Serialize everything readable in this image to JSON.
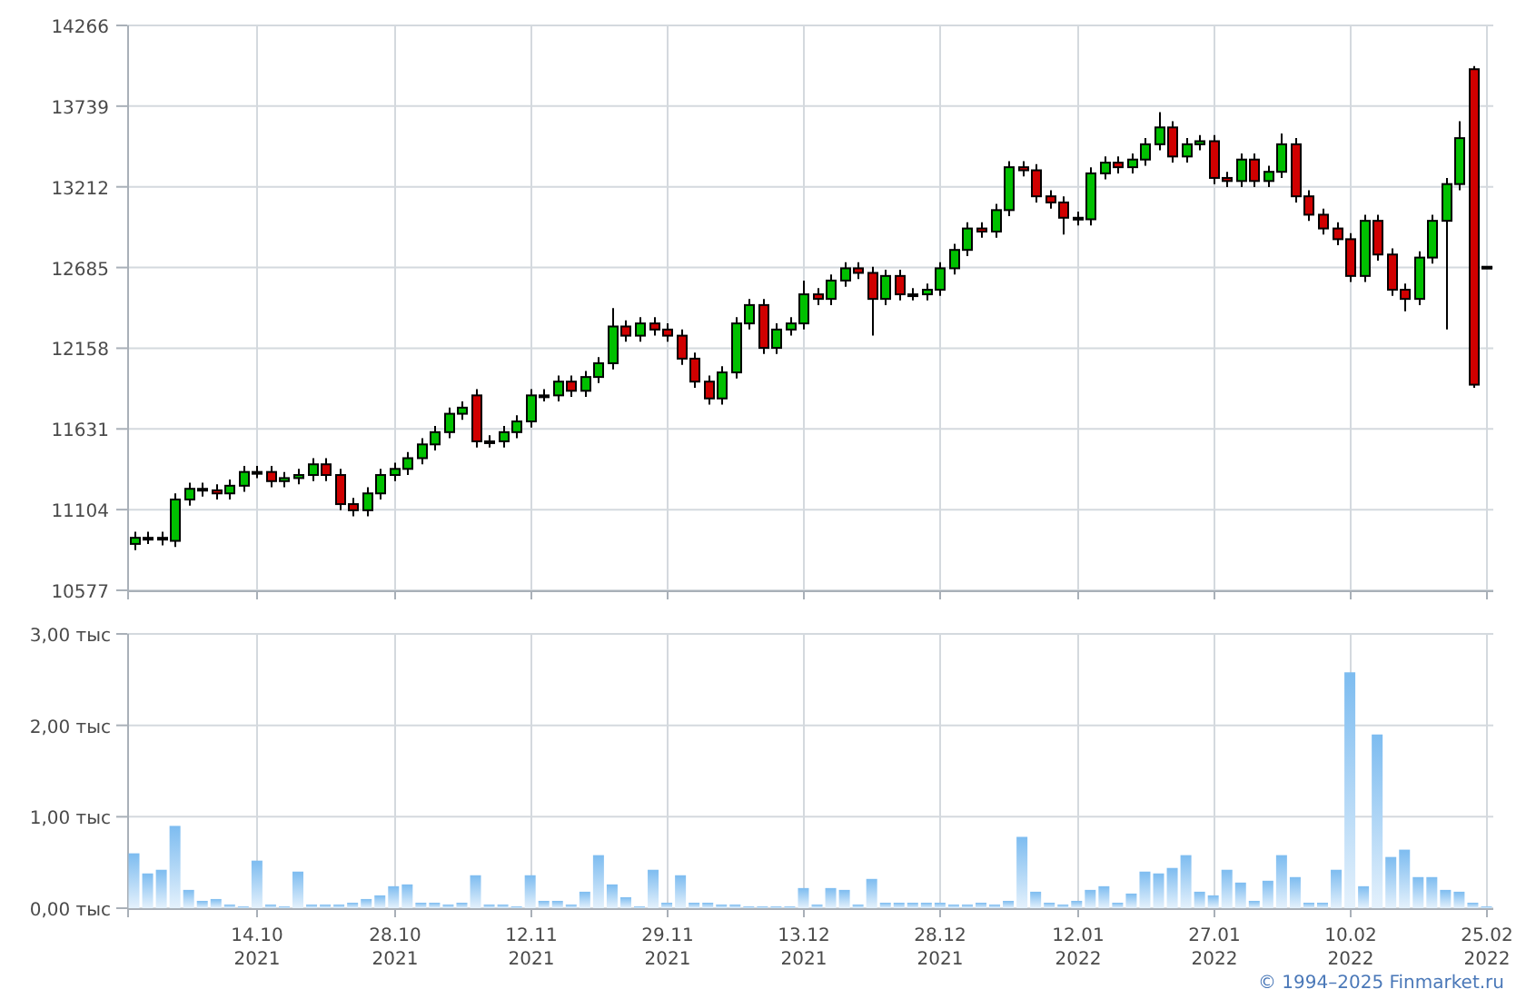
{
  "price_chart": {
    "chart_data": {
      "type": "candlestick",
      "grid": true,
      "ylim": [
        10577,
        14266
      ],
      "yticks": [
        10577,
        11104,
        11631,
        12158,
        12685,
        13212,
        13739,
        14266
      ],
      "categories": [
        null,
        null,
        null,
        null,
        null,
        null,
        null,
        null,
        null,
        null,
        null,
        null,
        null,
        null,
        null,
        null,
        null,
        null,
        null,
        null,
        null,
        null,
        null,
        null,
        null,
        null,
        null,
        null,
        null,
        null,
        null,
        null,
        null,
        null,
        null,
        null,
        null,
        null,
        null,
        null,
        null,
        null,
        null,
        null,
        null,
        null,
        null,
        null,
        null,
        null,
        null,
        null,
        null,
        null,
        null,
        null,
        null,
        null,
        null,
        null,
        null,
        null,
        null,
        null,
        null,
        null,
        null,
        null,
        null,
        null,
        null,
        null,
        null,
        null,
        null,
        null,
        null,
        null,
        null,
        null,
        null,
        null,
        null,
        null,
        null,
        null,
        null,
        null,
        null,
        null,
        null,
        null,
        null,
        null,
        null,
        null,
        null,
        null,
        null,
        null
      ],
      "ohlc": [
        [
          10880,
          10960,
          10840,
          10920
        ],
        [
          10920,
          10960,
          10880,
          10920
        ],
        [
          10920,
          10960,
          10870,
          10910
        ],
        [
          10900,
          11210,
          10860,
          11170
        ],
        [
          11170,
          11280,
          11130,
          11240
        ],
        [
          11240,
          11280,
          11190,
          11230
        ],
        [
          11230,
          11270,
          11170,
          11210
        ],
        [
          11210,
          11300,
          11170,
          11260
        ],
        [
          11260,
          11390,
          11220,
          11350
        ],
        [
          11350,
          11390,
          11310,
          11350
        ],
        [
          11350,
          11390,
          11250,
          11290
        ],
        [
          11290,
          11350,
          11250,
          11310
        ],
        [
          11310,
          11370,
          11270,
          11330
        ],
        [
          11330,
          11440,
          11290,
          11400
        ],
        [
          11400,
          11440,
          11290,
          11330
        ],
        [
          11330,
          11370,
          11100,
          11140
        ],
        [
          11140,
          11180,
          11060,
          11100
        ],
        [
          11100,
          11250,
          11060,
          11210
        ],
        [
          11210,
          11370,
          11170,
          11330
        ],
        [
          11330,
          11410,
          11290,
          11370
        ],
        [
          11370,
          11480,
          11330,
          11440
        ],
        [
          11440,
          11570,
          11400,
          11530
        ],
        [
          11530,
          11650,
          11490,
          11610
        ],
        [
          11610,
          11770,
          11570,
          11730
        ],
        [
          11730,
          11810,
          11690,
          11770
        ],
        [
          11850,
          11890,
          11510,
          11550
        ],
        [
          11550,
          11590,
          11510,
          11550
        ],
        [
          11550,
          11650,
          11510,
          11610
        ],
        [
          11610,
          11720,
          11570,
          11680
        ],
        [
          11680,
          11890,
          11640,
          11850
        ],
        [
          11850,
          11890,
          11810,
          11850
        ],
        [
          11850,
          11980,
          11810,
          11940
        ],
        [
          11940,
          11980,
          11840,
          11880
        ],
        [
          11880,
          12010,
          11840,
          11970
        ],
        [
          11970,
          12100,
          11930,
          12060
        ],
        [
          12060,
          12420,
          12020,
          12300
        ],
        [
          12300,
          12340,
          12200,
          12240
        ],
        [
          12240,
          12360,
          12200,
          12320
        ],
        [
          12320,
          12360,
          12240,
          12280
        ],
        [
          12280,
          12320,
          12200,
          12240
        ],
        [
          12240,
          12280,
          12050,
          12090
        ],
        [
          12090,
          12130,
          11900,
          11940
        ],
        [
          11940,
          11980,
          11790,
          11830
        ],
        [
          11830,
          12040,
          11790,
          12000
        ],
        [
          12000,
          12360,
          11960,
          12320
        ],
        [
          12320,
          12480,
          12280,
          12440
        ],
        [
          12440,
          12480,
          12120,
          12160
        ],
        [
          12160,
          12320,
          12120,
          12280
        ],
        [
          12280,
          12360,
          12240,
          12320
        ],
        [
          12320,
          12600,
          12280,
          12510
        ],
        [
          12510,
          12550,
          12440,
          12480
        ],
        [
          12480,
          12640,
          12440,
          12600
        ],
        [
          12600,
          12720,
          12560,
          12680
        ],
        [
          12680,
          12720,
          12610,
          12650
        ],
        [
          12650,
          12690,
          12240,
          12480
        ],
        [
          12480,
          12670,
          12440,
          12630
        ],
        [
          12630,
          12670,
          12470,
          12510
        ],
        [
          12510,
          12550,
          12470,
          12510
        ],
        [
          12510,
          12580,
          12470,
          12540
        ],
        [
          12540,
          12720,
          12500,
          12680
        ],
        [
          12680,
          12840,
          12640,
          12800
        ],
        [
          12800,
          12980,
          12760,
          12940
        ],
        [
          12940,
          12980,
          12880,
          12920
        ],
        [
          12920,
          13100,
          12880,
          13060
        ],
        [
          13060,
          13380,
          13020,
          13340
        ],
        [
          13340,
          13380,
          13280,
          13320
        ],
        [
          13320,
          13360,
          13110,
          13150
        ],
        [
          13150,
          13190,
          13070,
          13110
        ],
        [
          13110,
          13150,
          12900,
          13010
        ],
        [
          13010,
          13050,
          12960,
          13000
        ],
        [
          13000,
          13340,
          12960,
          13300
        ],
        [
          13300,
          13410,
          13260,
          13370
        ],
        [
          13370,
          13410,
          13300,
          13340
        ],
        [
          13340,
          13430,
          13300,
          13390
        ],
        [
          13390,
          13530,
          13350,
          13490
        ],
        [
          13490,
          13700,
          13450,
          13600
        ],
        [
          13600,
          13640,
          13370,
          13410
        ],
        [
          13410,
          13530,
          13370,
          13490
        ],
        [
          13490,
          13550,
          13450,
          13510
        ],
        [
          13510,
          13550,
          13230,
          13270
        ],
        [
          13270,
          13310,
          13210,
          13250
        ],
        [
          13250,
          13430,
          13210,
          13390
        ],
        [
          13390,
          13430,
          13210,
          13250
        ],
        [
          13250,
          13350,
          13210,
          13310
        ],
        [
          13310,
          13560,
          13270,
          13490
        ],
        [
          13490,
          13530,
          13110,
          13150
        ],
        [
          13150,
          13190,
          12990,
          13030
        ],
        [
          13030,
          13070,
          12900,
          12940
        ],
        [
          12940,
          12980,
          12830,
          12870
        ],
        [
          12870,
          12910,
          12590,
          12630
        ],
        [
          12630,
          13030,
          12590,
          12990
        ],
        [
          12990,
          13030,
          12730,
          12770
        ],
        [
          12770,
          12810,
          12500,
          12540
        ],
        [
          12540,
          12580,
          12400,
          12480
        ],
        [
          12480,
          12790,
          12440,
          12750
        ],
        [
          12750,
          13030,
          12710,
          12990
        ],
        [
          12990,
          13270,
          12280,
          13230
        ],
        [
          13230,
          13640,
          13190,
          13530
        ],
        [
          13980,
          14000,
          11900,
          11920
        ],
        [
          12690,
          12690,
          12690,
          12690
        ]
      ]
    }
  },
  "volume_chart": {
    "chart_data": {
      "type": "bar",
      "grid": true,
      "ylim": [
        0,
        3
      ],
      "yticks": [
        {
          "value": 0,
          "label": "0,00 тыс"
        },
        {
          "value": 1,
          "label": "1,00 тыс"
        },
        {
          "value": 2,
          "label": "2,00 тыс"
        },
        {
          "value": 3,
          "label": "3,00 тыс"
        }
      ],
      "categories": [
        null,
        null,
        null,
        null,
        null,
        null,
        null,
        null,
        null,
        "14.10 2021",
        null,
        null,
        null,
        null,
        null,
        null,
        null,
        null,
        null,
        "28.10 2021",
        null,
        null,
        null,
        null,
        null,
        null,
        null,
        null,
        null,
        "12.11 2021",
        null,
        null,
        null,
        null,
        null,
        null,
        null,
        null,
        null,
        "29.11 2021",
        null,
        null,
        null,
        null,
        null,
        null,
        null,
        null,
        null,
        "13.12 2021",
        null,
        null,
        null,
        null,
        null,
        null,
        null,
        null,
        null,
        "28.12 2021",
        null,
        null,
        null,
        null,
        null,
        null,
        null,
        null,
        null,
        "12.01 2022",
        null,
        null,
        null,
        null,
        null,
        null,
        null,
        null,
        null,
        "27.01 2022",
        null,
        null,
        null,
        null,
        null,
        null,
        null,
        null,
        null,
        "10.02 2022",
        null,
        null,
        null,
        null,
        null,
        null,
        null,
        null,
        null,
        "25.02 2022"
      ],
      "series": [
        {
          "color": "#7dbcf0",
          "values": [
            0.6,
            0.38,
            0.42,
            0.9,
            0.2,
            0.08,
            0.1,
            0.04,
            0.02,
            0.52,
            0.04,
            0.02,
            0.4,
            0.04,
            0.04,
            0.04,
            0.06,
            0.1,
            0.14,
            0.24,
            0.26,
            0.06,
            0.06,
            0.04,
            0.06,
            0.36,
            0.04,
            0.04,
            0.02,
            0.36,
            0.08,
            0.08,
            0.04,
            0.18,
            0.58,
            0.26,
            0.12,
            0.02,
            0.42,
            0.06,
            0.36,
            0.06,
            0.06,
            0.04,
            0.04,
            0.02,
            0.02,
            0.02,
            0.02,
            0.22,
            0.04,
            0.22,
            0.2,
            0.04,
            0.32,
            0.06,
            0.06,
            0.06,
            0.06,
            0.06,
            0.04,
            0.04,
            0.06,
            0.04,
            0.08,
            0.78,
            0.18,
            0.06,
            0.04,
            0.08,
            0.2,
            0.24,
            0.06,
            0.16,
            0.4,
            0.38,
            0.44,
            0.58,
            0.18,
            0.14,
            0.42,
            0.28,
            0.08,
            0.3,
            0.58,
            0.34,
            0.06,
            0.06,
            0.42,
            2.58,
            0.24,
            1.9,
            0.56,
            0.64,
            0.34,
            0.34,
            0.2,
            0.18,
            0.06,
            0.02
          ]
        }
      ]
    }
  },
  "copyright": "© 1994–2025 Finmarket.ru"
}
